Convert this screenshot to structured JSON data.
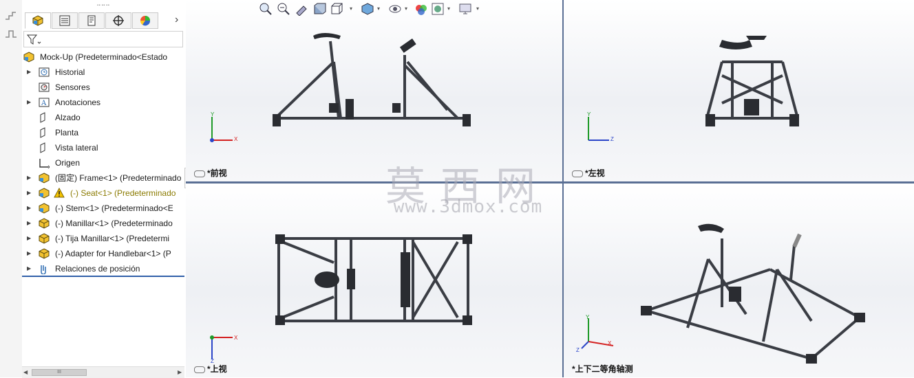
{
  "feature_manager": {
    "grip": "⠒⠒⠒",
    "tabs": [
      "feature-manager-tab",
      "property-manager-tab",
      "configuration-manager-tab",
      "dimxpert-tab",
      "display-manager-tab"
    ],
    "tabs_more": "›",
    "tree": [
      {
        "label": "Mock-Up  (Predeterminado<Estado",
        "icon": "assembly-icon",
        "expandable": false,
        "level": 0
      },
      {
        "label": "Historial",
        "icon": "history-icon",
        "expandable": true,
        "level": 1
      },
      {
        "label": "Sensores",
        "icon": "sensor-icon",
        "expandable": false,
        "level": 1
      },
      {
        "label": "Anotaciones",
        "icon": "annotation-icon",
        "expandable": true,
        "level": 1
      },
      {
        "label": "Alzado",
        "icon": "plane-icon",
        "expandable": false,
        "level": 1
      },
      {
        "label": "Planta",
        "icon": "plane-icon",
        "expandable": false,
        "level": 1
      },
      {
        "label": "Vista lateral",
        "icon": "plane-icon",
        "expandable": false,
        "level": 1
      },
      {
        "label": "Origen",
        "icon": "origin-icon",
        "expandable": false,
        "level": 1
      },
      {
        "label": "(固定) Frame<1> (Predeterminado",
        "icon": "subassembly-icon",
        "expandable": true,
        "level": 1
      },
      {
        "label": "(-) Seat<1> (Predeterminado",
        "icon": "subassembly-icon",
        "expandable": true,
        "level": 1,
        "warning": true
      },
      {
        "label": "(-) Stem<1> (Predeterminado<E",
        "icon": "subassembly-icon",
        "expandable": true,
        "level": 1
      },
      {
        "label": "(-) Manillar<1> (Predeterminado",
        "icon": "part-icon",
        "expandable": true,
        "level": 1
      },
      {
        "label": "(-) Tija Manillar<1> (Predetermi",
        "icon": "part-icon",
        "expandable": true,
        "level": 1
      },
      {
        "label": "(-) Adapter for Handlebar<1> (P",
        "icon": "part-icon",
        "expandable": true,
        "level": 1
      },
      {
        "label": "Relaciones de posición",
        "icon": "mate-icon",
        "expandable": true,
        "level": 1
      }
    ],
    "scroll_thumb": "III"
  },
  "viewports": {
    "front": {
      "label": "*前视"
    },
    "left": {
      "label": "*左视"
    },
    "top": {
      "label": "*上视"
    },
    "iso": {
      "label": "*上下二等角轴测"
    }
  },
  "axes": {
    "x": "X",
    "y": "Y",
    "z": "Z"
  },
  "watermark": {
    "cn": "莫西网",
    "url": "www.3dmox.com"
  },
  "colors": {
    "accent": "#2f5ea8",
    "x_axis": "#d42020",
    "y_axis": "#1e9a28",
    "z_axis": "#2b45c8",
    "frame": "#3a3d44"
  }
}
